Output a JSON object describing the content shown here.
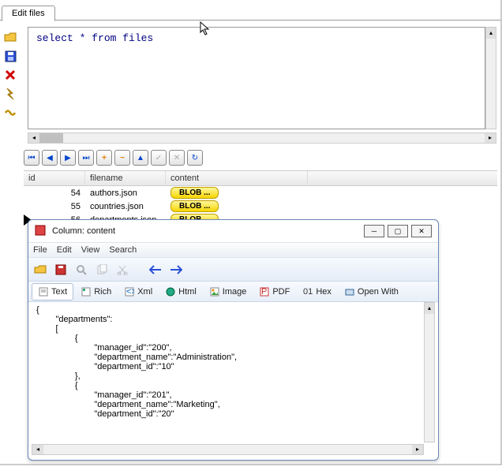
{
  "tab": {
    "label": "Edit files"
  },
  "sql": {
    "query": "select * from files"
  },
  "side_icons": {
    "open": "folder-open-icon",
    "save": "save-icon",
    "delete": "delete-icon",
    "run": "run-icon",
    "s": "script-icon"
  },
  "nav": {
    "first": "⏮",
    "prev": "◀",
    "next": "▶",
    "last": "⏭",
    "add": "+",
    "remove": "−",
    "up": "▲",
    "check": "✓",
    "cancel": "✕",
    "refresh": "↻"
  },
  "grid": {
    "headers": {
      "id": "id",
      "filename": "filename",
      "content": "content"
    },
    "rows": [
      {
        "id": "54",
        "filename": "authors.json",
        "content": "BLOB ..."
      },
      {
        "id": "55",
        "filename": "countries.json",
        "content": "BLOB ..."
      },
      {
        "id": "56",
        "filename": "departments.json",
        "content": "BLOB ..."
      }
    ]
  },
  "dialog": {
    "title": "Column: content",
    "menu": {
      "file": "File",
      "edit": "Edit",
      "view": "View",
      "search": "Search"
    },
    "tabs": {
      "text": "Text",
      "rich": "Rich",
      "xml": "Xml",
      "html": "Html",
      "image": "Image",
      "pdf": "PDF",
      "hex": "Hex",
      "openwith": "Open With"
    },
    "text_content": "{\n        \"departments\":\n        [\n                {\n                        \"manager_id\":\"200\",\n                        \"department_name\":\"Administration\",\n                        \"department_id\":\"10\"\n                },\n                {\n                        \"manager_id\":\"201\",\n                        \"department_name\":\"Marketing\",\n                        \"department_id\":\"20\""
  },
  "chart_data": {
    "type": "table",
    "title": "files",
    "columns": [
      "id",
      "filename",
      "content"
    ],
    "rows": [
      [
        54,
        "authors.json",
        "BLOB"
      ],
      [
        55,
        "countries.json",
        "BLOB"
      ],
      [
        56,
        "departments.json",
        "BLOB"
      ]
    ]
  }
}
